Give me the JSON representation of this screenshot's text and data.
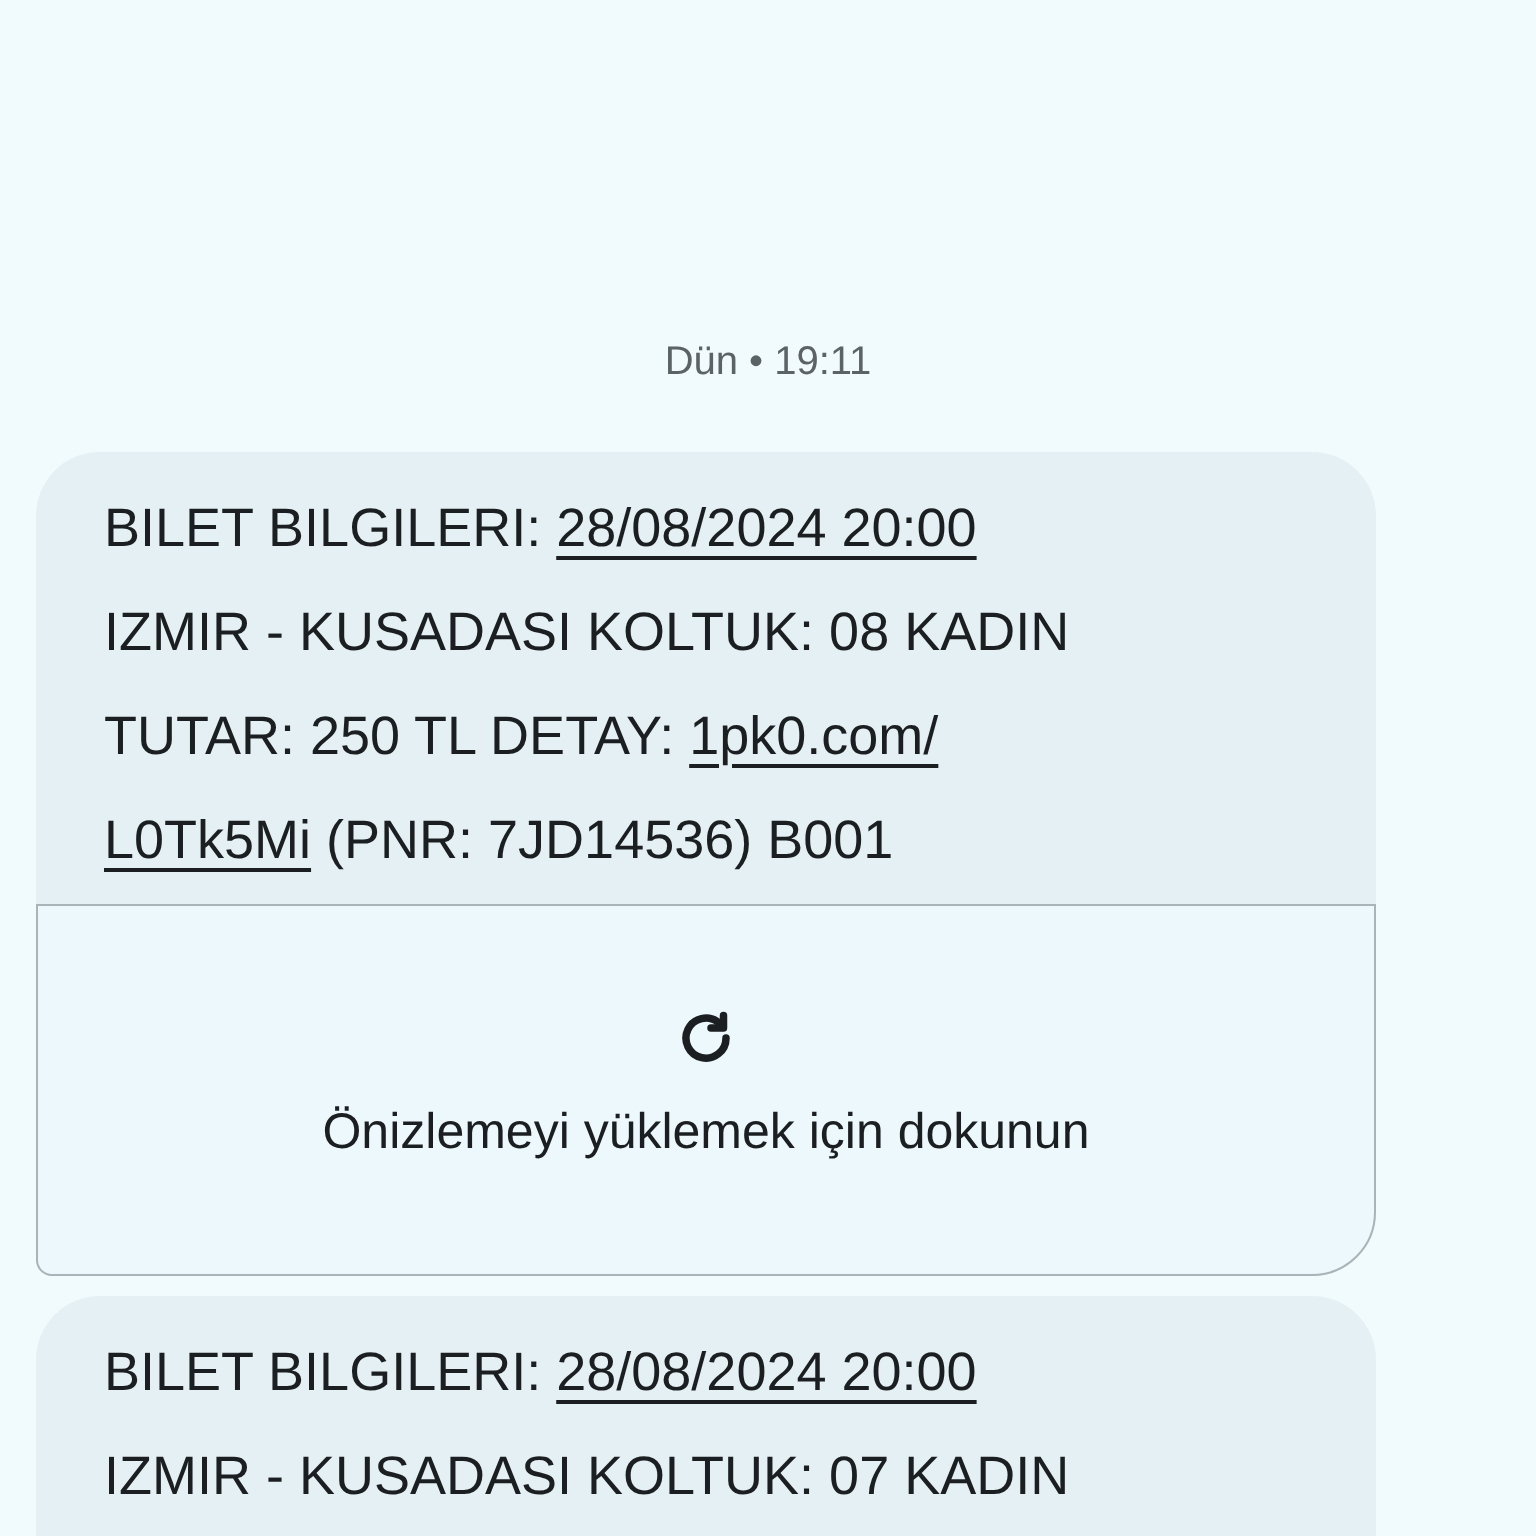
{
  "timestamp": "Dün • 19:11",
  "messages": [
    {
      "lines": [
        [
          {
            "text": "BILET BILGILERI: ",
            "link": false
          },
          {
            "text": "28/08/2024 20:00",
            "link": true
          }
        ],
        [
          {
            "text": "IZMIR - KUSADASI KOLTUK: 08 KADIN",
            "link": false
          }
        ],
        [
          {
            "text": "TUTAR: 250 TL DETAY: ",
            "link": false
          },
          {
            "text": "1pk0.com/",
            "link": true
          }
        ],
        [
          {
            "text": "L0Tk5Mi",
            "link": true
          },
          {
            "text": " (PNR: 7JD14536) B001",
            "link": false
          }
        ]
      ],
      "preview": {
        "label": "Önizlemeyi yüklemek için dokunun"
      }
    },
    {
      "lines": [
        [
          {
            "text": "BILET BILGILERI: ",
            "link": false
          },
          {
            "text": "28/08/2024 20:00",
            "link": true
          }
        ],
        [
          {
            "text": "IZMIR - KUSADASI KOLTUK: 07 KADIN",
            "link": false
          }
        ]
      ]
    }
  ]
}
